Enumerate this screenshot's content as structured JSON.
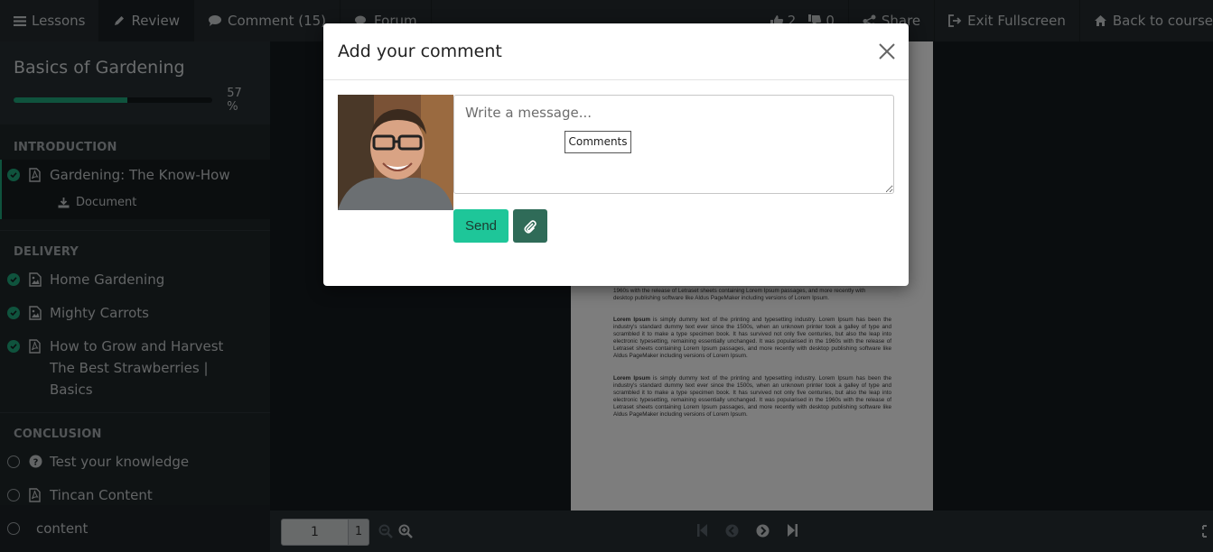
{
  "topbar": {
    "tabs": [
      {
        "label": "Lessons",
        "icon": "bars-icon"
      },
      {
        "label": "Review",
        "icon": "pencil-icon"
      },
      {
        "label": "Comment (15)",
        "icon": "comment-icon"
      },
      {
        "label": "Forum",
        "icon": "comments-icon"
      }
    ],
    "likes": "2",
    "dislikes": "0",
    "share_label": "Share",
    "exit_fullscreen_label": "Exit Fullscreen",
    "back_label": "Back to course"
  },
  "sidebar": {
    "course_title": "Basics of Gardening",
    "progress": 57,
    "progress_label": "57 %",
    "sections": [
      {
        "title": "INTRODUCTION",
        "lessons": [
          {
            "label": "Gardening: The Know-How",
            "status": "done",
            "type": "pdf-icon",
            "sub_item": "Document"
          }
        ]
      },
      {
        "title": "DELIVERY",
        "lessons": [
          {
            "label": "Home Gardening",
            "status": "done",
            "type": "image-icon"
          },
          {
            "label": "Mighty Carrots",
            "status": "done",
            "type": "image-icon"
          },
          {
            "label": "How to Grow and Harvest The Best Strawberries | Basics",
            "status": "done",
            "type": "pdf-icon"
          }
        ]
      },
      {
        "title": "CONCLUSION",
        "lessons": [
          {
            "label": "Test your knowledge",
            "status": "todo",
            "type": "question-icon"
          },
          {
            "label": "Tincan Content",
            "status": "todo",
            "type": "pdf-icon"
          },
          {
            "label": "content",
            "status": "todo",
            "type": ""
          }
        ]
      }
    ]
  },
  "document": {
    "partial_line_1": "1960s with the release of Letraset sheets containing Lorem Ipsum passages, and more recently with",
    "partial_line_2": "desktop publishing software like Aldus PageMaker including versions of Lorem Ipsum.",
    "paragraph_lead": "Lorem Ipsum",
    "paragraph_body": " is simply dummy text of the printing and typesetting industry. Lorem Ipsum has been the industry's standard dummy text ever since the 1500s, when an unknown printer took a galley of type and scrambled it to make a type specimen book. It has survived not only five centuries, but also the leap into electronic typesetting, remaining essentially unchanged. It was popularised in the 1960s with the release of Letraset sheets containing Lorem Ipsum passages, and more recently with desktop publishing software like Aldus PageMaker including versions of Lorem Ipsum."
  },
  "bottombar": {
    "page_value": "1",
    "page_total": "1"
  },
  "modal": {
    "title": "Add your comment",
    "message_placeholder": "Write a message...",
    "tooltip": "Comments",
    "send_label": "Send"
  },
  "colors": {
    "accent": "#1ea67a",
    "send": "#1ec699",
    "attach": "#2f6b58"
  }
}
